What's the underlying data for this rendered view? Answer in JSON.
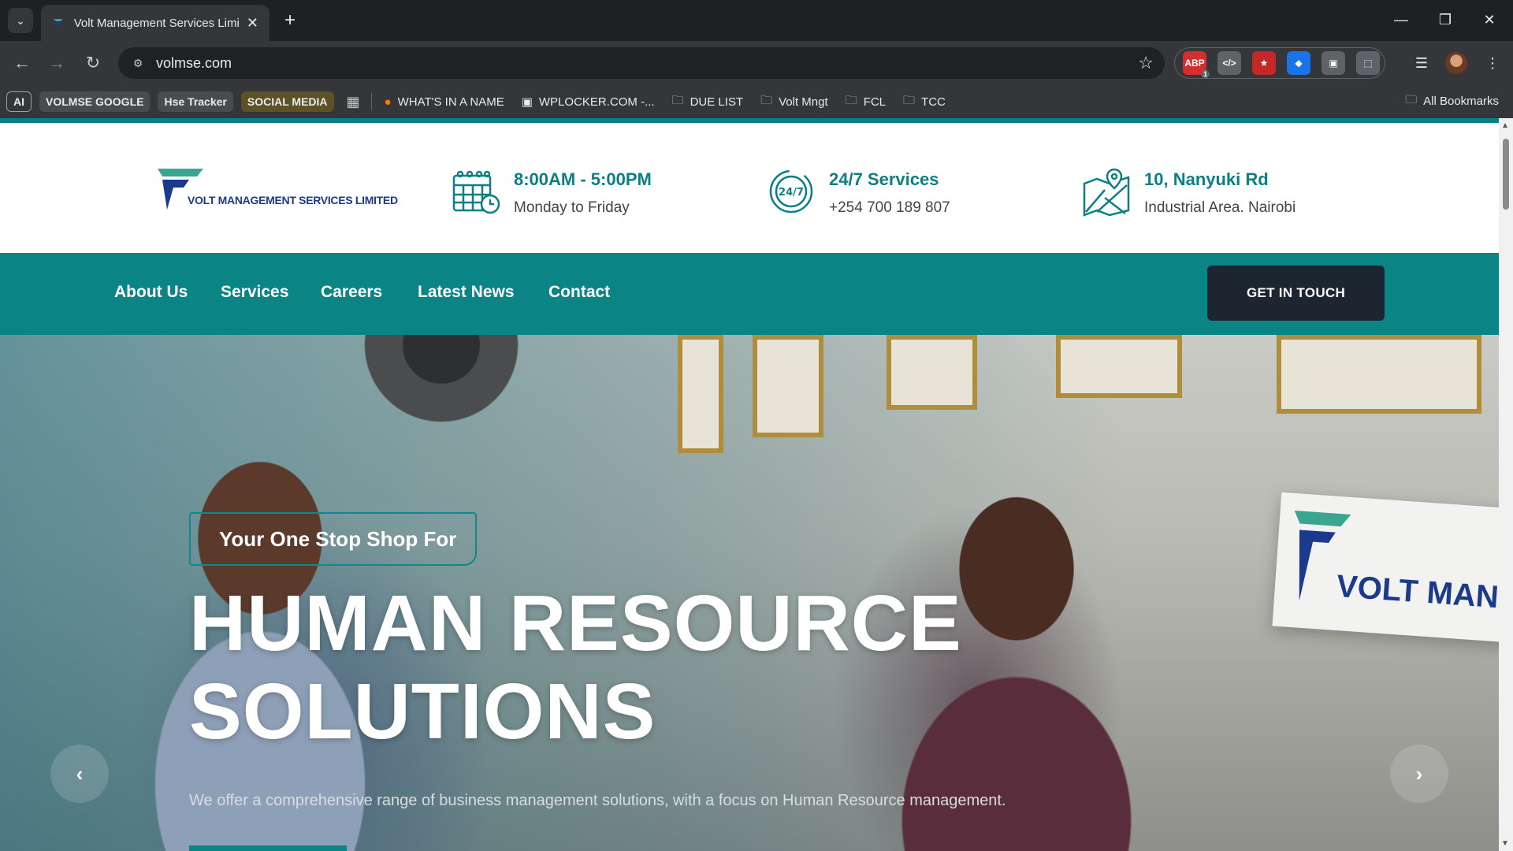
{
  "browser": {
    "tab_title": "Volt Management Services Limi",
    "url": "volmse.com",
    "window_controls": [
      "minimize-icon",
      "restore-icon",
      "close-icon"
    ],
    "extensions": [
      {
        "name": "abp-extension-icon",
        "label": "ABP",
        "badge": "1",
        "color": "#d32f2f"
      },
      {
        "name": "code-extension-icon",
        "label": "</>",
        "color": "#5f6368"
      },
      {
        "name": "star-extension-icon",
        "label": "★",
        "color": "#c62828"
      },
      {
        "name": "tag-extension-icon",
        "label": "◆",
        "color": "#1a73e8"
      },
      {
        "name": "copy-extension-icon",
        "label": "▣",
        "color": "#5f6368"
      },
      {
        "name": "puzzle-extension-icon",
        "label": "⬚",
        "color": "#5f6368"
      }
    ]
  },
  "bookmarks": {
    "chips": [
      {
        "label": "AI",
        "bg": "#35363a",
        "border": "#9aa0a6"
      },
      {
        "label": "VOLMSE GOOGLE",
        "bg": "#4a4b4f",
        "border": ""
      },
      {
        "label": "Hse Tracker",
        "bg": "#4a4b4f",
        "border": ""
      },
      {
        "label": "SOCIAL MEDIA",
        "bg": "#5b5227",
        "border": ""
      }
    ],
    "items": [
      {
        "label": "WHAT'S IN A NAME",
        "icon": "firefox-icon"
      },
      {
        "label": "WPLOCKER.COM -...",
        "icon": "wplocker-icon"
      },
      {
        "label": "DUE LIST",
        "icon": "folder-icon"
      },
      {
        "label": "Volt Mngt",
        "icon": "folder-icon"
      },
      {
        "label": "FCL",
        "icon": "folder-icon"
      },
      {
        "label": "TCC",
        "icon": "folder-icon"
      }
    ],
    "all_bookmarks": "All Bookmarks"
  },
  "site": {
    "logo_text": "VOLT MANAGEMENT SERVICES LIMITED",
    "info": [
      {
        "title": "8:00AM - 5:00PM",
        "sub": "Monday to Friday",
        "icon": "calendar-clock-icon"
      },
      {
        "title": "24/7 Services",
        "sub": "+254 700 189 807",
        "icon": "support-247-icon",
        "icon_text": "24/7"
      },
      {
        "title": "10, Nanyuki Rd",
        "sub": "Industrial Area. Nairobi",
        "icon": "map-pin-icon"
      }
    ],
    "nav": [
      "About Us",
      "Services",
      "Careers",
      "Latest News",
      "Contact"
    ],
    "cta": "GET IN TOUCH",
    "hero": {
      "tagline": "Your One Stop Shop For",
      "headline_line1": "HUMAN RESOURCE",
      "headline_line2": "SOLUTIONS",
      "description": "We offer a comprehensive range of business management solutions, with a focus on Human Resource management.",
      "sign_text": "VOLT MANAGE",
      "prev_icon": "chevron-left-icon",
      "next_icon": "chevron-right-icon"
    }
  },
  "colors": {
    "brand_teal": "#0b8486",
    "brand_navy": "#1b3a8c",
    "cta_dark": "#1d2530"
  }
}
